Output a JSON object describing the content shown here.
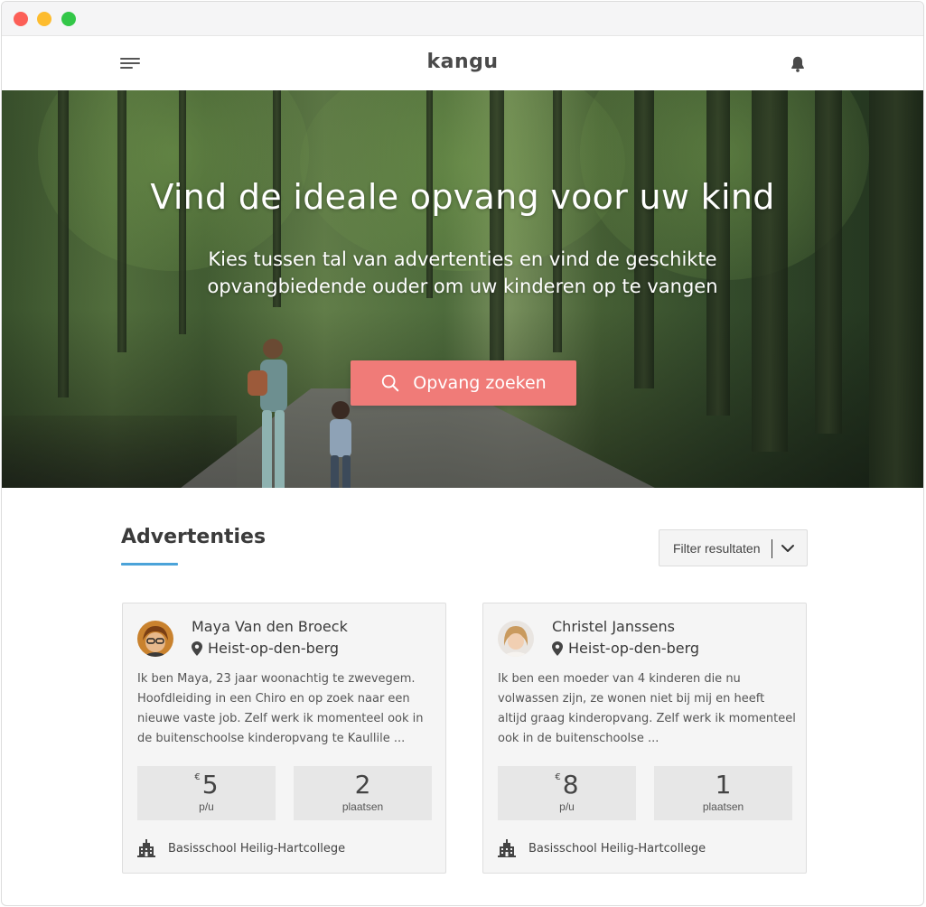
{
  "app": {
    "logo": "kangu"
  },
  "icons": {
    "menu": "hamburger-menu-icon",
    "notifications": "bell-icon",
    "search": "search-icon",
    "location": "map-pin-icon",
    "school": "school-building-icon",
    "filter_toggle": "chevron-down-icon"
  },
  "colors": {
    "accent_button": "#f07b78",
    "section_underline": "#4ba3d9"
  },
  "hero": {
    "title": "Vind de ideale opvang voor uw kind",
    "subtitle": "Kies tussen tal van advertenties en vind de geschikte opvangbiedende ouder om uw kinderen op te vangen",
    "search_button": "Opvang zoeken"
  },
  "listings": {
    "title": "Advertenties",
    "filter_label": "Filter resultaten",
    "cards": [
      {
        "name": "Maya Van den Broeck",
        "location": "Heist-op-den-berg",
        "description": "Ik ben Maya, 23 jaar woonachtig te zwevegem. Hoofdleiding in een Chiro en op zoek naar een nieuwe vaste job. Zelf werk ik momenteel ook in de buitenschoolse kinderopvang te Kaullile ...",
        "currency": "€",
        "price": "5",
        "price_unit": "p/u",
        "places": "2",
        "places_label": "plaatsen",
        "school": "Basisschool Heilig-Hartcollege"
      },
      {
        "name": "Christel Janssens",
        "location": "Heist-op-den-berg",
        "description": "Ik ben een moeder van 4 kinderen die nu volwassen zijn, ze wonen niet bij mij en heeft altijd graag kinderopvang. Zelf werk ik momenteel ook in de buitenschoolse ...",
        "currency": "€",
        "price": "8",
        "price_unit": "p/u",
        "places": "1",
        "places_label": "plaatsen",
        "school": "Basisschool Heilig-Hartcollege"
      }
    ]
  }
}
